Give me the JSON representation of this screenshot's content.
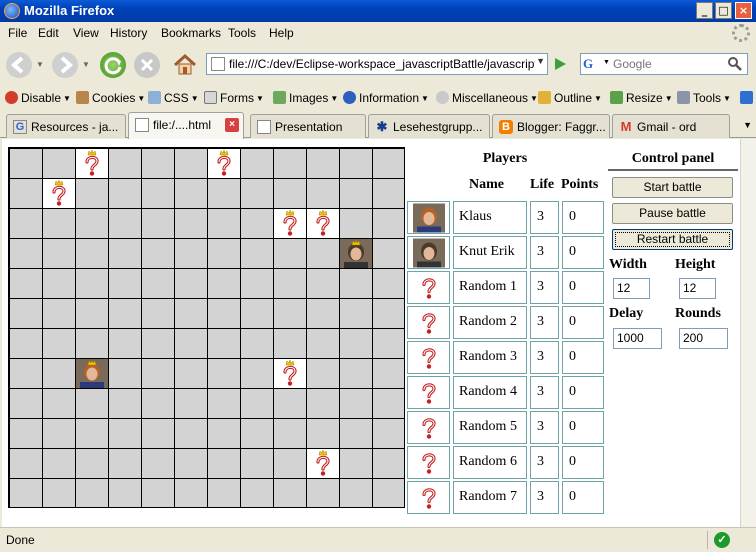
{
  "window": {
    "title": "Mozilla Firefox"
  },
  "menu": [
    "File",
    "Edit",
    "View",
    "History",
    "Bookmarks",
    "Tools",
    "Help"
  ],
  "nav": {
    "url": "file:///C:/dev/Eclipse-workspace_javascriptBattle/javascriptBa",
    "search_placeholder": "Google",
    "search_engine_icon": "G"
  },
  "devbar": [
    "Disable",
    "Cookies",
    "CSS",
    "Forms",
    "Images",
    "Information",
    "Miscellaneous",
    "Outline",
    "Resize",
    "Tools"
  ],
  "tabs": [
    {
      "label": "Resources - ja...",
      "icon": "google-icon"
    },
    {
      "label": "file:/....html",
      "icon": "page-icon",
      "active": true
    },
    {
      "label": "Presentation",
      "icon": "page-icon"
    },
    {
      "label": "Lesehestgrupp...",
      "icon": "star-icon"
    },
    {
      "label": "Blogger: Faggr...",
      "icon": "blogger-icon"
    },
    {
      "label": "Gmail - ord",
      "icon": "gmail-icon"
    }
  ],
  "players": {
    "title": "Players",
    "headers": {
      "name": "Name",
      "life": "Life",
      "points": "Points"
    },
    "rows": [
      {
        "name": "Klaus",
        "life": "3",
        "points": "0",
        "avatar": "photo"
      },
      {
        "name": "Knut Erik",
        "life": "3",
        "points": "0",
        "avatar": "photo"
      },
      {
        "name": "Random 1",
        "life": "3",
        "points": "0",
        "avatar": "question-mark"
      },
      {
        "name": "Random 2",
        "life": "3",
        "points": "0",
        "avatar": "question-mark"
      },
      {
        "name": "Random 3",
        "life": "3",
        "points": "0",
        "avatar": "question-mark"
      },
      {
        "name": "Random 4",
        "life": "3",
        "points": "0",
        "avatar": "question-mark"
      },
      {
        "name": "Random 5",
        "life": "3",
        "points": "0",
        "avatar": "question-mark"
      },
      {
        "name": "Random 6",
        "life": "3",
        "points": "0",
        "avatar": "question-mark"
      },
      {
        "name": "Random 7",
        "life": "3",
        "points": "0",
        "avatar": "question-mark"
      }
    ]
  },
  "board": {
    "cols": 12,
    "rows": 12,
    "pieces": [
      {
        "col": 2,
        "row": 0,
        "kind": "question-mark"
      },
      {
        "col": 6,
        "row": 0,
        "kind": "question-mark"
      },
      {
        "col": 1,
        "row": 1,
        "kind": "question-mark"
      },
      {
        "col": 8,
        "row": 2,
        "kind": "question-mark"
      },
      {
        "col": 9,
        "row": 2,
        "kind": "question-mark"
      },
      {
        "col": 10,
        "row": 3,
        "kind": "photo-knut-erik"
      },
      {
        "col": 2,
        "row": 7,
        "kind": "photo-klaus"
      },
      {
        "col": 8,
        "row": 7,
        "kind": "question-mark"
      },
      {
        "col": 9,
        "row": 10,
        "kind": "question-mark"
      }
    ]
  },
  "control": {
    "title": "Control panel",
    "start": "Start battle",
    "pause": "Pause battle",
    "restart": "Restart battle",
    "width_label": "Width",
    "height_label": "Height",
    "width": "12",
    "height": "12",
    "delay_label": "Delay",
    "rounds_label": "Rounds",
    "delay": "1000",
    "rounds": "200"
  },
  "status": {
    "text": "Done"
  }
}
